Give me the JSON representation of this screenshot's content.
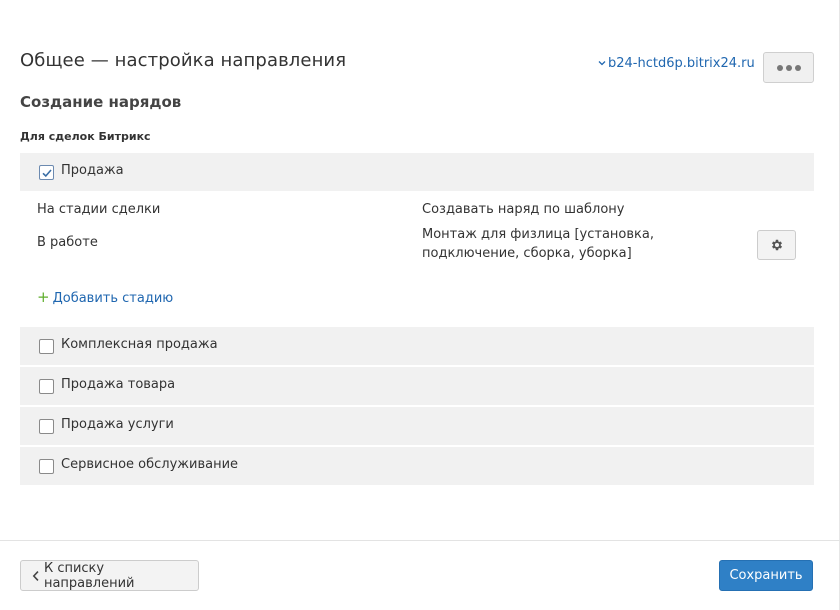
{
  "header": {
    "title": "Общее — настройка направления",
    "portal_link": "b24-hctd6p.bitrix24.ru"
  },
  "section": {
    "title": "Создание нарядов",
    "subtitle": "Для сделок Битрикс"
  },
  "deal_types": [
    {
      "label": "Продажа",
      "checked": true,
      "stages_header": "На стадии сделки",
      "template_header": "Создавать наряд по шаблону",
      "stages": [
        {
          "stage": "В работе",
          "template": "Монтаж для физлица [установка, подключение, сборка, уборка]"
        }
      ],
      "add_stage_label": "Добавить стадию"
    },
    {
      "label": "Комплексная продажа",
      "checked": false
    },
    {
      "label": "Продажа товара",
      "checked": false
    },
    {
      "label": "Продажа услуги",
      "checked": false
    },
    {
      "label": "Сервисное обслуживание",
      "checked": false
    }
  ],
  "footer": {
    "back_label": "К списку направлений",
    "save_label": "Сохранить"
  },
  "colors": {
    "link": "#2067b0",
    "primary_button": "#2f80c6",
    "add_plus": "#5fae2d",
    "row_background": "#f1f1f1"
  },
  "icons": {
    "more": "more-dots-icon",
    "settings": "gear-icon",
    "back": "chevron-left-icon",
    "portal": "chevron-down-icon",
    "add": "plus-icon"
  }
}
